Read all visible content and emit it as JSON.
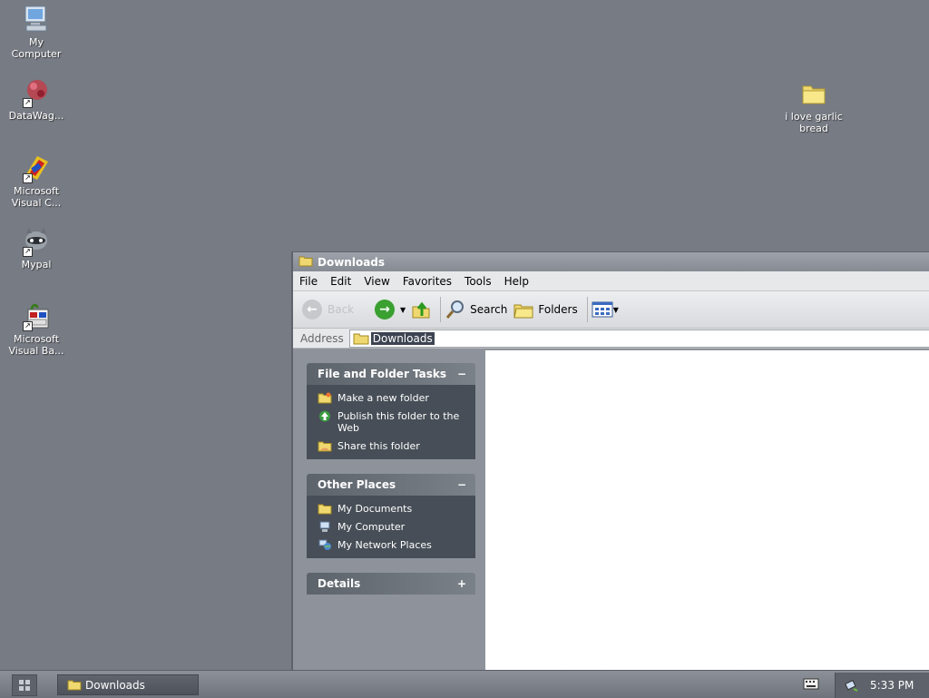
{
  "desktop": {
    "icons": [
      {
        "label_line1": "My",
        "label_line2": "Computer",
        "icon": "my-computer-icon"
      },
      {
        "label_line1": "DataWag...",
        "label_line2": "",
        "icon": "datawag-icon"
      },
      {
        "label_line1": "Microsoft",
        "label_line2": "Visual C...",
        "icon": "visual-c-icon"
      },
      {
        "label_line1": "Mypal",
        "label_line2": "",
        "icon": "mypal-icon"
      },
      {
        "label_line1": "Microsoft",
        "label_line2": "Visual Ba...",
        "icon": "visual-basic-icon"
      },
      {
        "label_line1": "i love garlic",
        "label_line2": "bread",
        "icon": "folder-icon"
      }
    ]
  },
  "window": {
    "title": "Downloads",
    "menu": [
      "File",
      "Edit",
      "View",
      "Favorites",
      "Tools",
      "Help"
    ],
    "toolbar": {
      "back_label": "Back",
      "search_label": "Search",
      "folders_label": "Folders"
    },
    "address": {
      "label": "Address",
      "value": "Downloads"
    },
    "taskpane": {
      "file_tasks": {
        "title": "File and Folder Tasks",
        "toggle": "−",
        "items": [
          "Make a new folder",
          "Publish this folder to the Web",
          "Share this folder"
        ]
      },
      "other_places": {
        "title": "Other Places",
        "toggle": "−",
        "items": [
          "My Documents",
          "My Computer",
          "My Network Places"
        ]
      },
      "details": {
        "title": "Details",
        "toggle": "+"
      }
    }
  },
  "taskbar": {
    "task_label": "Downloads",
    "clock": "5:33 PM"
  }
}
